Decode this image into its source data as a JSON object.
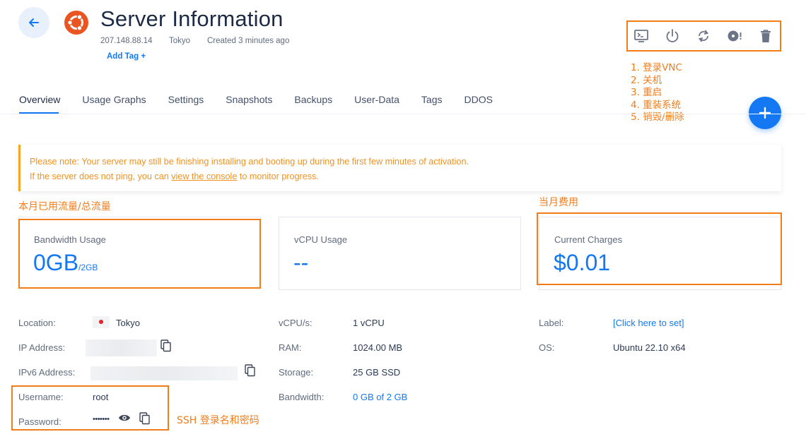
{
  "header": {
    "title": "Server Information",
    "ip": "207.148.88.14",
    "location": "Tokyo",
    "created": "Created 3 minutes ago",
    "add_tag": "Add Tag +"
  },
  "toolbar": {
    "icons": [
      "vnc-console-icon",
      "power-icon",
      "restart-icon",
      "reinstall-icon",
      "trash-icon"
    ]
  },
  "annotations": {
    "toolbar_list": [
      "1. 登录VNC",
      "2. 关机",
      "3. 重启",
      "4. 重装系统",
      "5. 销毁/删除"
    ],
    "bandwidth": "本月已用流量/总流量",
    "charges": "当月费用",
    "ssh": "SSH 登录名和密码"
  },
  "tabs": [
    "Overview",
    "Usage Graphs",
    "Settings",
    "Snapshots",
    "Backups",
    "User-Data",
    "Tags",
    "DDOS"
  ],
  "active_tab": "Overview",
  "notice": {
    "line1": "Please note: Your server may still be finishing installing and booting up during the first few minutes of activation.",
    "line2_before": "If the server does not ping, you can ",
    "line2_link": "view the console",
    "line2_after": " to monitor progress."
  },
  "cards": {
    "bandwidth": {
      "label": "Bandwidth Usage",
      "value": "0GB",
      "suffix": "/2GB"
    },
    "vcpu": {
      "label": "vCPU Usage",
      "value": "--"
    },
    "charges": {
      "label": "Current Charges",
      "value": "$0.01"
    }
  },
  "details": {
    "location_label": "Location:",
    "location_value": "Tokyo",
    "ip_label": "IP Address:",
    "ipv6_label": "IPv6 Address:",
    "username_label": "Username:",
    "username_value": "root",
    "password_label": "Password:",
    "password_value": "•••••••",
    "vcpus_label": "vCPU/s:",
    "vcpus_value": "1 vCPU",
    "ram_label": "RAM:",
    "ram_value": "1024.00 MB",
    "storage_label": "Storage:",
    "storage_value": "25 GB SSD",
    "bandwidth_label": "Bandwidth:",
    "bandwidth_value": "0 GB of 2 GB",
    "label_label": "Label:",
    "label_value": "[Click here to set]",
    "os_label": "OS:",
    "os_value": "Ubuntu 22.10 x64"
  },
  "colors": {
    "accent": "#1478f2",
    "annotation": "#f07d1a",
    "notice": "#f2921f",
    "ubuntu": "#e95420"
  }
}
